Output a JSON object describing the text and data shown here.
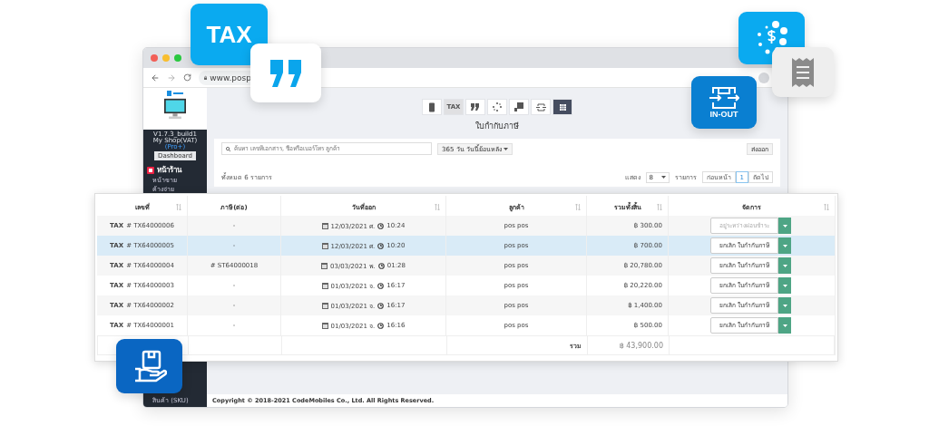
{
  "browser": {
    "url": "www.posp"
  },
  "sidebar": {
    "version": "V1.7.3_build1",
    "shop": "My Shop(VAT)",
    "plan": "(Pro+)",
    "dashboard": "Dashboard",
    "section": "หน้าร้าน",
    "items": [
      {
        "label": "หน้าขาย"
      },
      {
        "label": "ค้างจ่าย"
      }
    ],
    "bottom": "สินค้า (SKU)"
  },
  "toolbar": [
    {
      "kind": "receipt",
      "selected": false
    },
    {
      "kind": "tax",
      "label": "TAX",
      "selected": true
    },
    {
      "kind": "quote",
      "selected": false
    },
    {
      "kind": "dots",
      "selected": false
    },
    {
      "kind": "box",
      "selected": false
    },
    {
      "kind": "inout",
      "selected": false
    },
    {
      "kind": "grid",
      "selected": true
    }
  ],
  "page_title": "ใบกำกับภาษี",
  "search": {
    "placeholder": "ค้นหา เลขที่เอกสาร, ชื่อหรือเบอร์โทร ลูกค้า"
  },
  "date_filter": "365 วัน วันนี้ย้อนหลัง",
  "export": "ส่งออก",
  "total_count": "ทั้งหมด 6 รายการ",
  "pagination": {
    "show": "แสดง",
    "per_page": "8",
    "unit": "รายการ",
    "prev": "ก่อนหน้า",
    "page": "1",
    "next": "ถัดไป"
  },
  "table": {
    "columns": [
      "เลขที่",
      "ภาษี(ต่อ)",
      "วันที่ออก",
      "ลูกค้า",
      "รวมทั้งสิ้น",
      "จัดการ"
    ],
    "rows": [
      {
        "tag": "TAX",
        "number": "# TX64000006",
        "ref": "-",
        "date": "12/03/2021 ศ.",
        "time": "10:24",
        "customer": "pos pos",
        "total": "฿ 300.00",
        "action": "อยู่ระหว่างผ่อนชำระ",
        "muted": true,
        "selected": false
      },
      {
        "tag": "TAX",
        "number": "# TX64000005",
        "ref": "-",
        "date": "12/03/2021 ศ.",
        "time": "10:20",
        "customer": "pos pos",
        "total": "฿ 700.00",
        "action": "ยกเลิก ใบกำกับภาษี",
        "muted": false,
        "selected": true
      },
      {
        "tag": "TAX",
        "number": "# TX64000004",
        "ref": "# ST64000018",
        "date": "03/03/2021 พ.",
        "time": "01:28",
        "customer": "pos pos",
        "total": "฿ 20,780.00",
        "action": "ยกเลิก ใบกำกับภาษี",
        "muted": false,
        "selected": false
      },
      {
        "tag": "TAX",
        "number": "# TX64000003",
        "ref": "-",
        "date": "01/03/2021 จ.",
        "time": "16:17",
        "customer": "pos pos",
        "total": "฿ 20,220.00",
        "action": "ยกเลิก ใบกำกับภาษี",
        "muted": false,
        "selected": false
      },
      {
        "tag": "TAX",
        "number": "# TX64000002",
        "ref": "-",
        "date": "01/03/2021 จ.",
        "time": "16:17",
        "customer": "pos pos",
        "total": "฿ 1,400.00",
        "action": "ยกเลิก ใบกำกับภาษี",
        "muted": false,
        "selected": false
      },
      {
        "tag": "TAX",
        "number": "# TX64000001",
        "ref": "-",
        "date": "01/03/2021 จ.",
        "time": "16:16",
        "customer": "pos pos",
        "total": "฿ 500.00",
        "action": "ยกเลิก ใบกำกับภาษี",
        "muted": false,
        "selected": false
      }
    ],
    "footer_label": "รวม",
    "footer_total": "฿ 43,900.00"
  },
  "copyright": "Copyright © 2018-2021 CodeMobiles Co., Ltd. All Rights Reserved.",
  "floating_tiles": [
    {
      "kind": "tax",
      "label": "TAX"
    },
    {
      "kind": "quote"
    },
    {
      "kind": "coins"
    },
    {
      "kind": "receipt"
    },
    {
      "kind": "inout",
      "label": "IN-OUT"
    },
    {
      "kind": "hand-box"
    }
  ]
}
